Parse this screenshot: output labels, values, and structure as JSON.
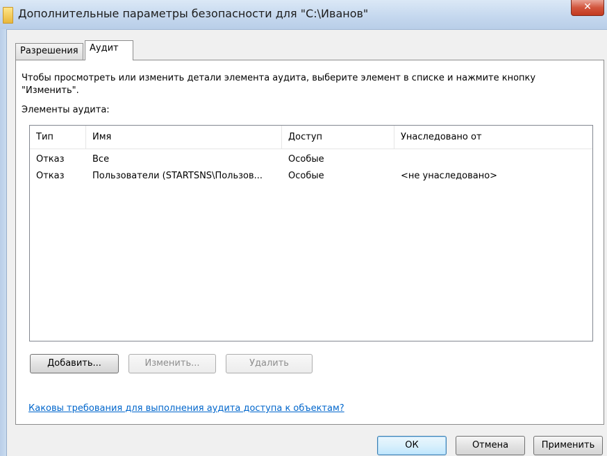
{
  "window": {
    "title": "Дополнительные параметры безопасности  для \"C:\\Иванов\"",
    "close_glyph": "✕"
  },
  "tabs": [
    {
      "label": "Разрешения",
      "selected": false
    },
    {
      "label": "Аудит",
      "selected": true
    }
  ],
  "audit": {
    "description": "Чтобы просмотреть или изменить детали элемента аудита, выберите элемент в списке и нажмите кнопку \"Изменить\".",
    "list_label": "Элементы аудита:",
    "columns": [
      "Тип",
      "Имя",
      "Доступ",
      "Унаследовано от"
    ],
    "rows": [
      {
        "type": "Отказ",
        "name": "Все",
        "access": "Особые",
        "inherited": ""
      },
      {
        "type": "Отказ",
        "name": "Пользователи (STARTSNS\\Пользов...",
        "access": "Особые",
        "inherited": "<не унаследовано>"
      }
    ],
    "buttons": {
      "add": "Добавить...",
      "edit": "Изменить...",
      "delete": "Удалить"
    },
    "help_link": "Каковы требования для выполнения аудита доступа к объектам?"
  },
  "footer": {
    "ok": "ОК",
    "cancel": "Отмена",
    "apply": "Применить"
  }
}
